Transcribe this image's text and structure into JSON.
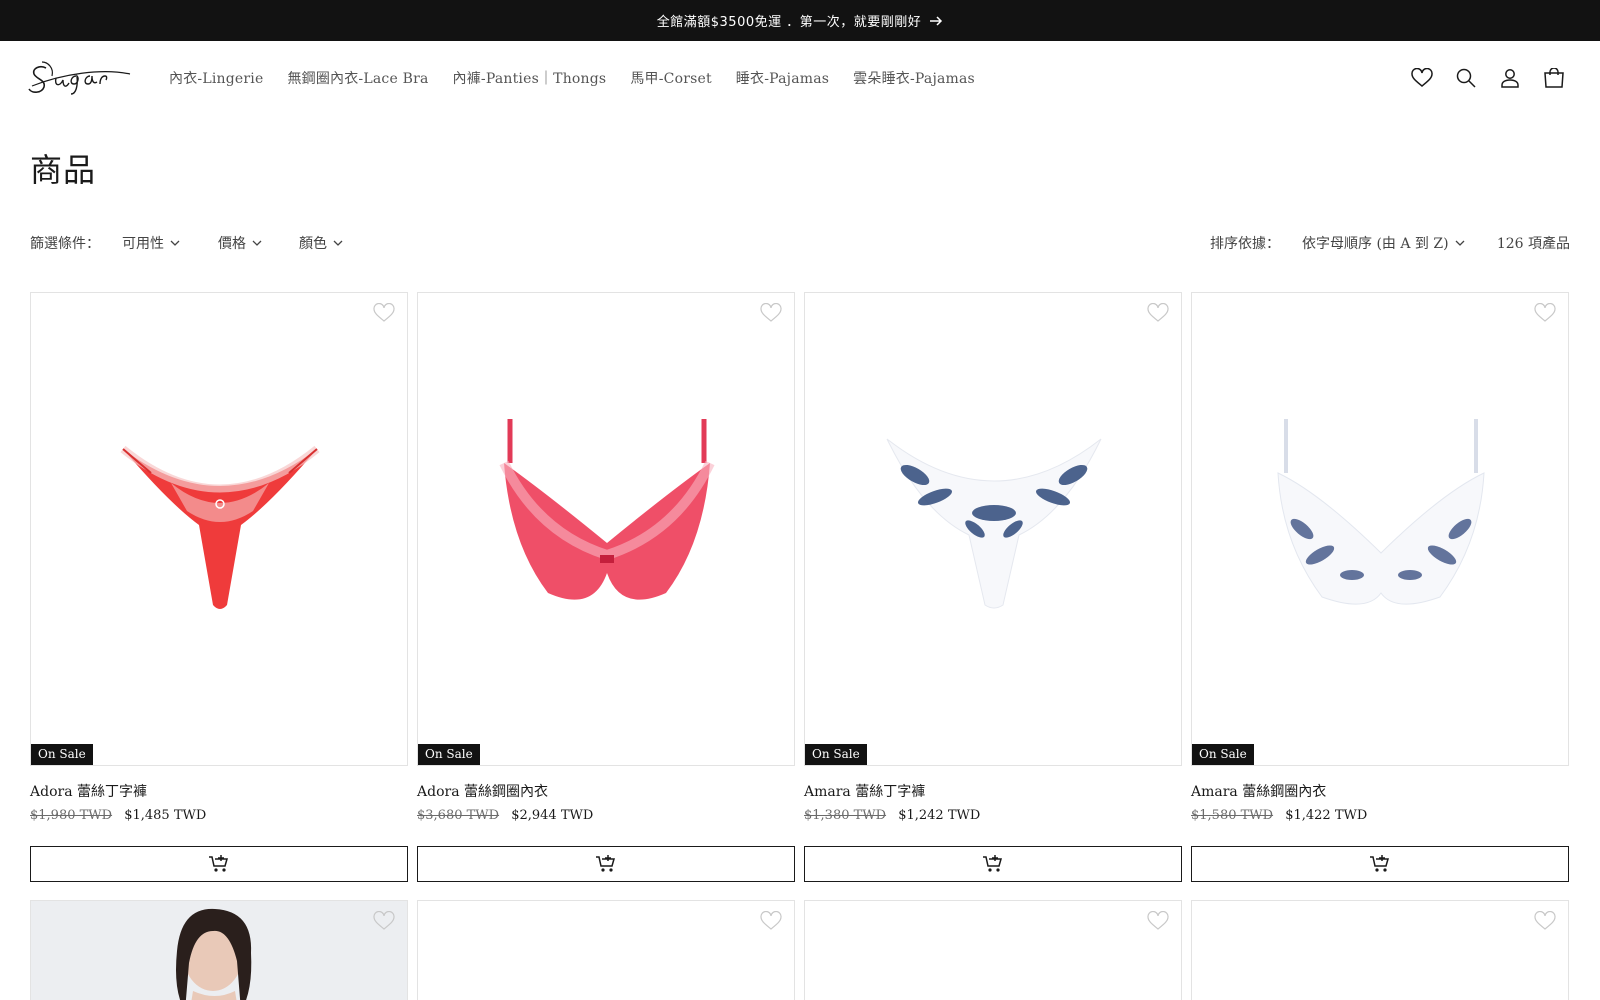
{
  "announcement": {
    "text": "全館滿額$3500免運 ．第一次，就要剛剛好"
  },
  "header": {
    "logo_text": "Sugar",
    "nav": [
      "內衣-Lingerie",
      "無鋼圈內衣-Lace Bra",
      "內褲-Panties｜Thongs",
      "馬甲-Corset",
      "睡衣-Pajamas",
      "雲朵睡衣-Pajamas"
    ],
    "icons": [
      "heart-icon",
      "search-icon",
      "account-icon",
      "cart-icon"
    ]
  },
  "page": {
    "title": "商品"
  },
  "filters": {
    "label": "篩選條件：",
    "items": [
      "可用性",
      "價格",
      "顏色"
    ],
    "sort_label": "排序依據：",
    "sort_value": "依字母順序 (由 A 到 Z)",
    "count": "126 項產品"
  },
  "products": [
    {
      "name": "Adora 蕾絲丁字褲",
      "old_price": "$1,980 TWD",
      "price": "$1,485 TWD",
      "badge": "On Sale",
      "color": "#ef3b3b"
    },
    {
      "name": "Adora 蕾絲鋼圈內衣",
      "old_price": "$3,680 TWD",
      "price": "$2,944 TWD",
      "badge": "On Sale",
      "color": "#ef4f68"
    },
    {
      "name": "Amara 蕾絲丁字褲",
      "old_price": "$1,380 TWD",
      "price": "$1,242 TWD",
      "badge": "On Sale",
      "color": "#2f4a7a"
    },
    {
      "name": "Amara 蕾絲鋼圈內衣",
      "old_price": "$1,580 TWD",
      "price": "$1,422 TWD",
      "badge": "On Sale",
      "color": "#4a5d8c"
    }
  ]
}
